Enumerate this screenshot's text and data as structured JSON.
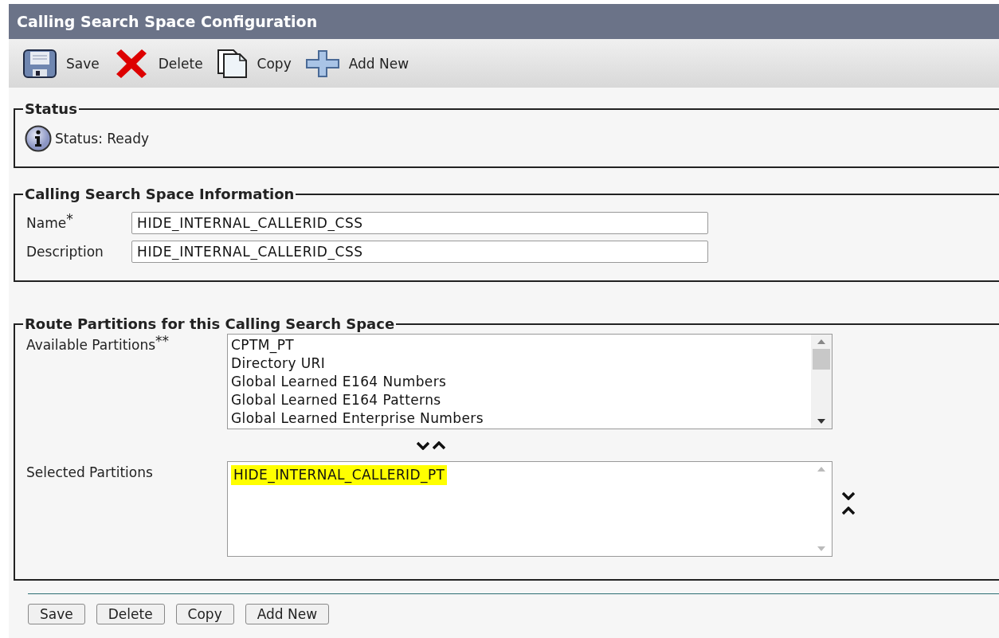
{
  "window": {
    "title": "Calling Search Space Configuration"
  },
  "toolbar": [
    {
      "kind": "save",
      "label": "Save"
    },
    {
      "kind": "delete",
      "label": "Delete"
    },
    {
      "kind": "copy",
      "label": "Copy"
    },
    {
      "kind": "add",
      "label": "Add New"
    }
  ],
  "status": {
    "legend": "Status",
    "text": "Status: Ready"
  },
  "information": {
    "legend": "Calling Search Space Information",
    "fields": [
      {
        "label": "Name",
        "required_mark": "*",
        "value": "HIDE_INTERNAL_CALLERID_CSS"
      },
      {
        "label": "Description",
        "value": "HIDE_INTERNAL_CALLERID_CSS"
      }
    ]
  },
  "partitions": {
    "legend": "Route Partitions for this Calling Search Space",
    "available": {
      "label": "Available Partitions",
      "required_mark": "**",
      "items": [
        "CPTM_PT",
        "Directory URI",
        "Global Learned E164 Numbers",
        "Global Learned E164 Patterns",
        "Global Learned Enterprise Numbers"
      ]
    },
    "selected": {
      "label": "Selected Partitions",
      "items": [
        {
          "text": "HIDE_INTERNAL_CALLERID_PT",
          "highlighted": true
        }
      ]
    }
  },
  "buttons": [
    "Save",
    "Delete",
    "Copy",
    "Add New"
  ]
}
